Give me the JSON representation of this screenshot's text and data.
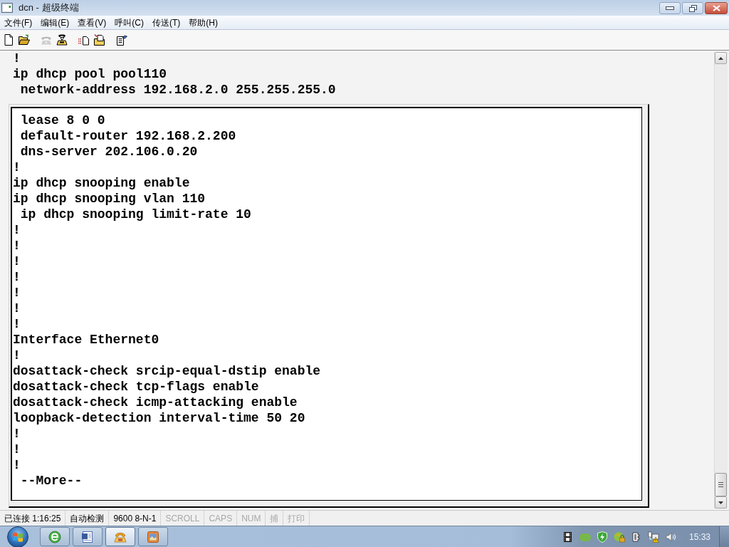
{
  "window": {
    "title": "dcn - 超级终端"
  },
  "menu": [
    "文件(F)",
    "编辑(E)",
    "查看(V)",
    "呼叫(C)",
    "传送(T)",
    "帮助(H)"
  ],
  "toolbar": [
    [
      {
        "kind": "new",
        "disabled": false
      },
      {
        "kind": "open",
        "disabled": false
      }
    ],
    [
      {
        "kind": "call",
        "disabled": true
      },
      {
        "kind": "disconnect",
        "disabled": false
      }
    ],
    [
      {
        "kind": "send",
        "disabled": false
      },
      {
        "kind": "receive",
        "disabled": false
      }
    ],
    [
      {
        "kind": "properties",
        "disabled": false
      }
    ]
  ],
  "terminal": {
    "lines": [
      "!",
      "ip dhcp pool pool110",
      " network-address 192.168.2.0 255.255.255.0"
    ],
    "panel": {
      "lines": [
        " lease 8 0 0",
        " default-router 192.168.2.200",
        " dns-server 202.106.0.20",
        "!",
        "ip dhcp snooping enable",
        "ip dhcp snooping vlan 110",
        " ip dhcp snooping limit-rate 10",
        "!",
        "!",
        "!",
        "!",
        "!",
        "!",
        "!",
        "Interface Ethernet0",
        "!",
        "dosattack-check srcip-equal-dstip enable",
        "dosattack-check tcp-flags enable",
        "dosattack-check icmp-attacking enable",
        "loopback-detection interval-time 50 20",
        "!",
        "!",
        "!",
        " --More--"
      ]
    }
  },
  "status_bar": [
    {
      "text": "已连接 1:16:25",
      "disabled": false
    },
    {
      "text": "自动检测",
      "disabled": false
    },
    {
      "text": "9600 8-N-1",
      "disabled": false
    },
    {
      "text": "SCROLL",
      "disabled": true
    },
    {
      "text": "CAPS",
      "disabled": true
    },
    {
      "text": "NUM",
      "disabled": true
    },
    {
      "text": "捕",
      "disabled": true
    },
    {
      "text": "打印",
      "disabled": true
    }
  ],
  "taskbar": {
    "buttons": [
      {
        "kind": "browser",
        "selected": false
      },
      {
        "kind": "document",
        "selected": false
      },
      {
        "kind": "terminal",
        "selected": true
      },
      {
        "kind": "picture",
        "selected": false
      }
    ],
    "tray": [
      {
        "kind": "film"
      },
      {
        "kind": "app"
      },
      {
        "kind": "shield"
      },
      {
        "kind": "globe-lock"
      },
      {
        "kind": "power"
      },
      {
        "kind": "network-warning"
      },
      {
        "kind": "volume"
      }
    ],
    "clock": "15:33"
  }
}
